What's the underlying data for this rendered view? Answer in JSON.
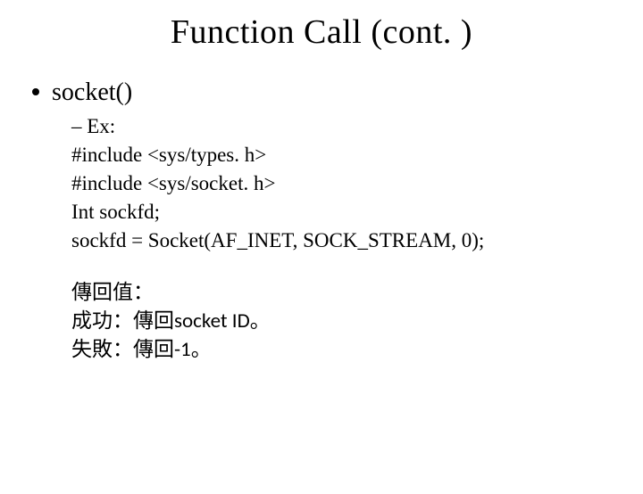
{
  "title": "Function Call (cont. )",
  "bullet1": "socket()",
  "sub": {
    "dash": "– Ex:",
    "line1": "#include <sys/types. h>",
    "line2": "#include <sys/socket. h>",
    "line3": "Int sockfd;",
    "line4": "sockfd = Socket(AF_INET, SOCK_STREAM, 0);"
  },
  "ret": {
    "l1": "傳回值：",
    "l2a": "成功：傳回",
    "l2b": "socket ID",
    "l2c": "。",
    "l3a": "失敗：傳回",
    "l3b": "-1",
    "l3c": "。"
  }
}
